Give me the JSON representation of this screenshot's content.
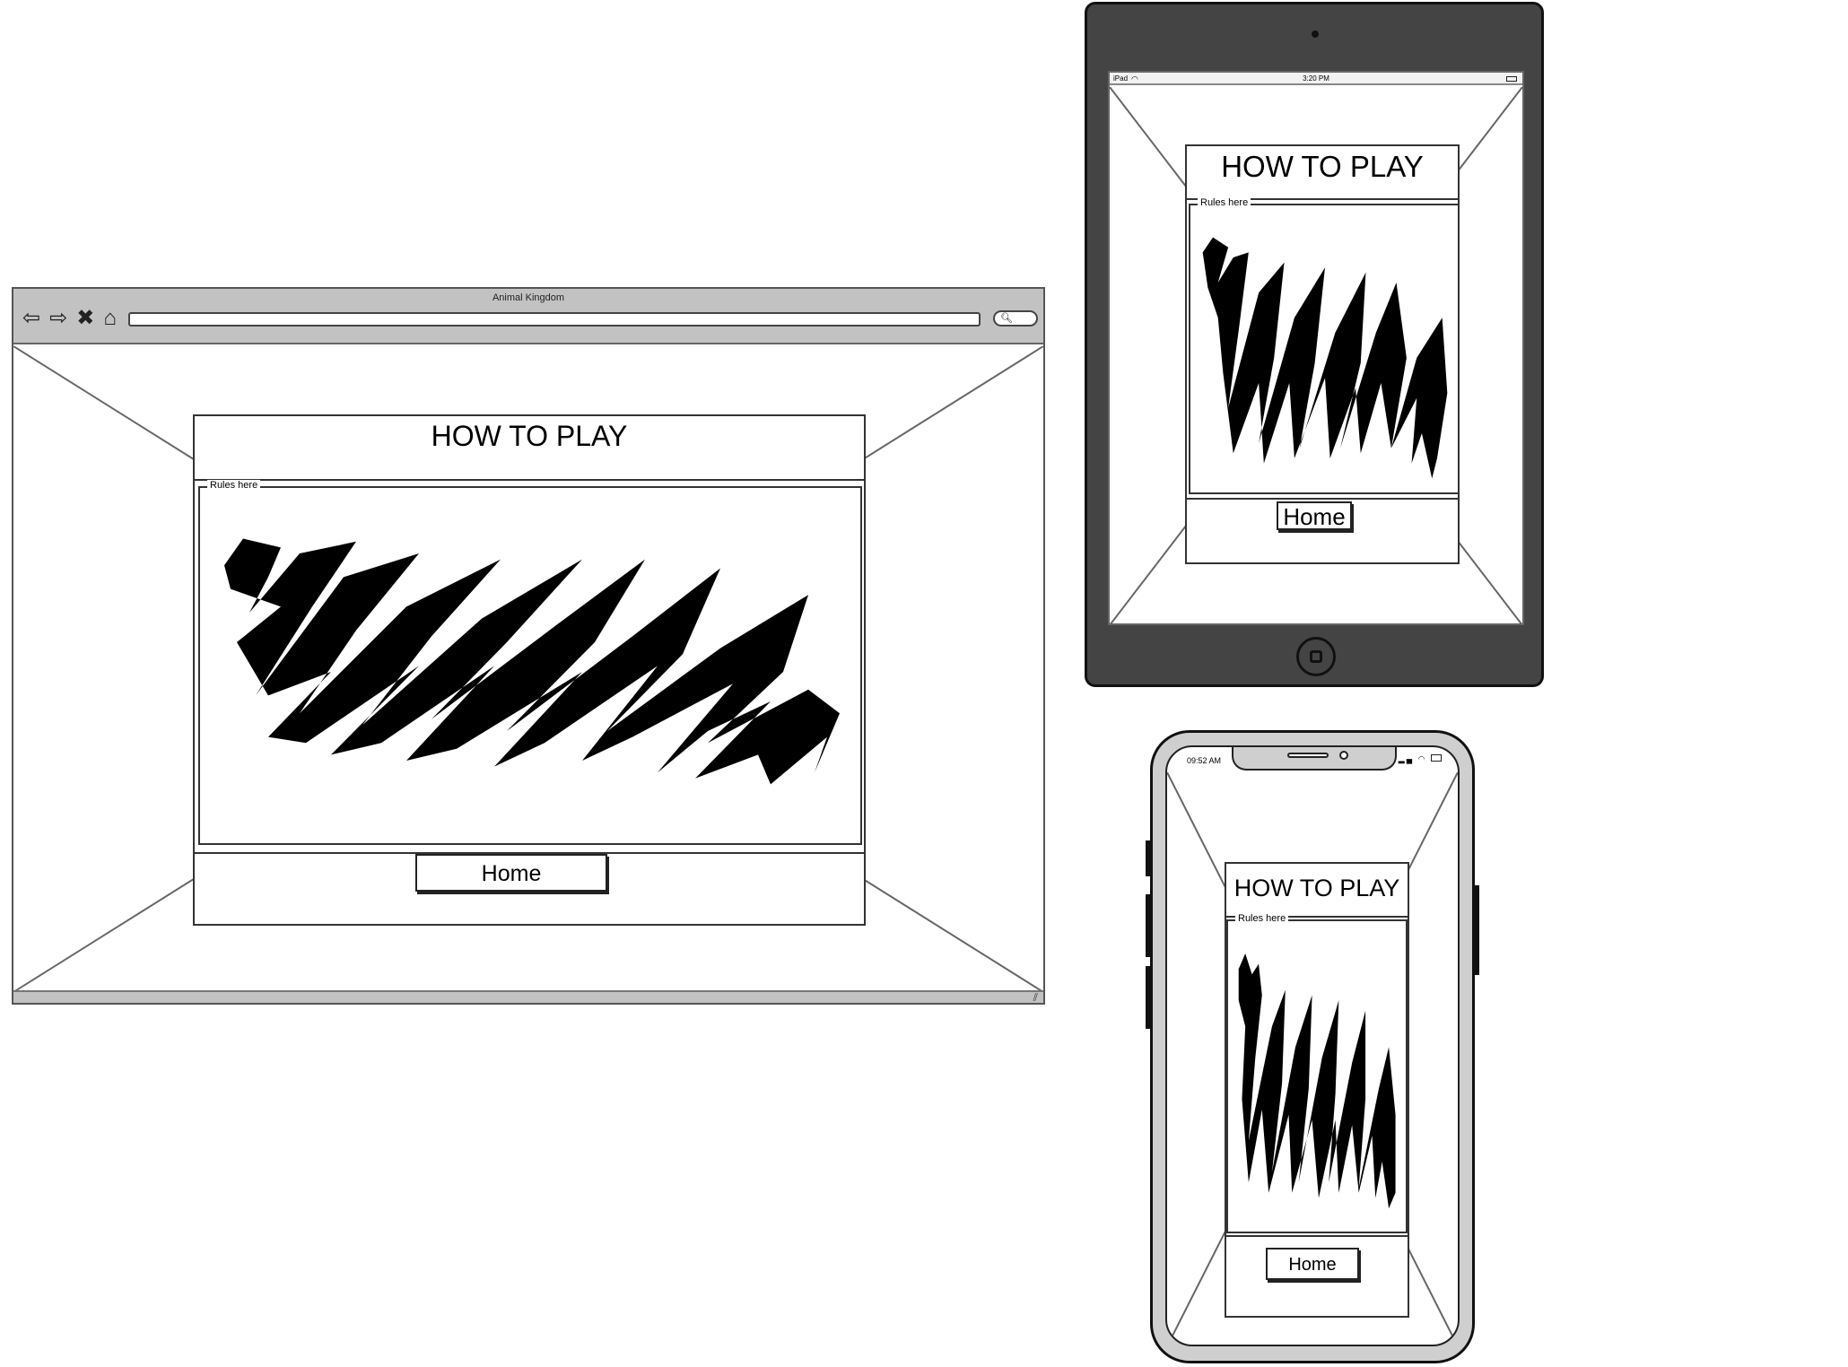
{
  "browser": {
    "window_title": "Animal Kingdom",
    "nav_icons": [
      "back-arrow-icon",
      "forward-arrow-icon",
      "close-x-icon",
      "home-icon"
    ],
    "search_icon": "search-icon"
  },
  "tablet": {
    "device_label": "iPad",
    "clock": "3:20 PM"
  },
  "phone": {
    "clock": "09:52 AM"
  },
  "page": {
    "title": "HOW TO PLAY",
    "rules_label": "Rules here",
    "home_button": "Home"
  }
}
